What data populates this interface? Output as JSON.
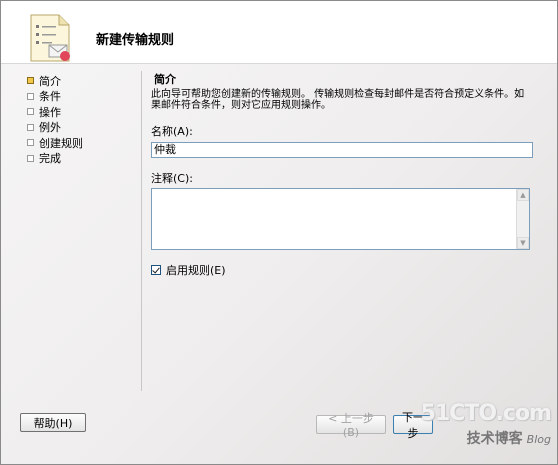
{
  "wizard": {
    "title": "新建传输规则",
    "steps": [
      {
        "label": "简介",
        "active": true
      },
      {
        "label": "条件",
        "active": false
      },
      {
        "label": "操作",
        "active": false
      },
      {
        "label": "例外",
        "active": false
      },
      {
        "label": "创建规则",
        "active": false
      },
      {
        "label": "完成",
        "active": false
      }
    ]
  },
  "intro": {
    "section_title": "简介",
    "description": "此向导可帮助您创建新的传输规则。 传输规则检查每封邮件是否符合预定义条件。如果邮件符合条件，则对它应用规则操作。"
  },
  "form": {
    "name_label": "名称(A):",
    "name_value": "仲裁",
    "notes_label": "注释(C):",
    "notes_value": "",
    "enable_label": "启用规则(E)",
    "enable_checked": true
  },
  "buttons": {
    "help": "帮助(H)",
    "back": "< 上一步(B)",
    "next": "下一步"
  },
  "watermark": {
    "logo": "51CTO.com",
    "subtitle": "技术博客",
    "blog": "Blog"
  },
  "colors": {
    "active_step": "#f1c84a",
    "input_border": "#7b9ebd"
  }
}
